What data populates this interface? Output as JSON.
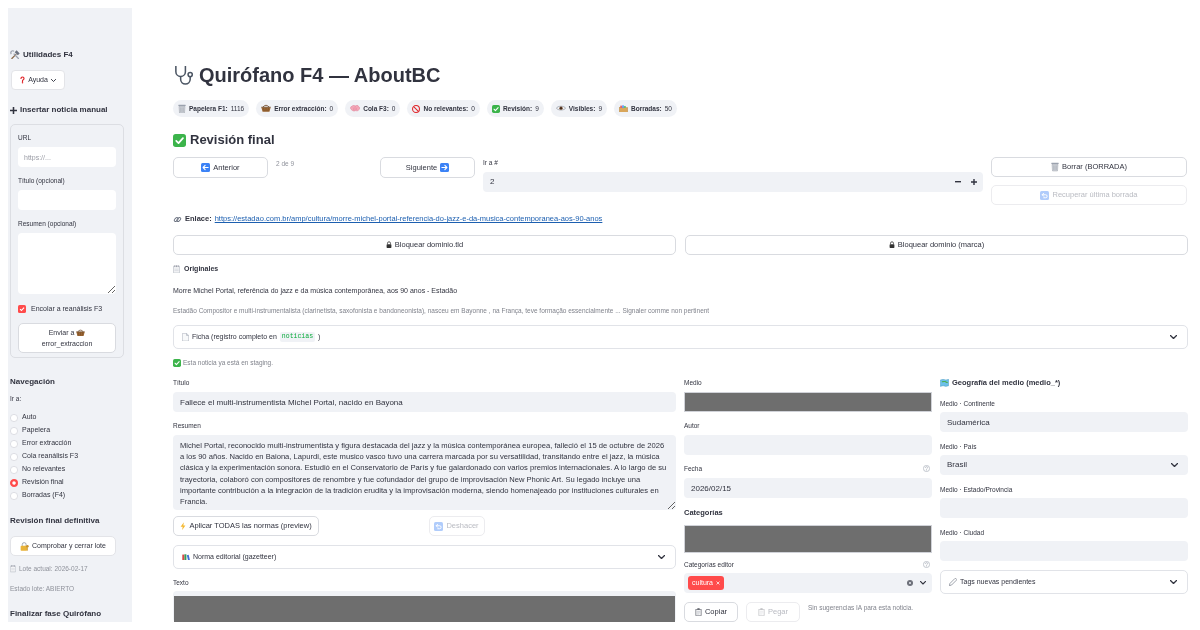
{
  "sidebar": {
    "utilities_title": "Utilidades F4",
    "help_button": {
      "label": "Ayuda",
      "expanded": false
    },
    "manual_insert": {
      "title": "Insertar noticia manual",
      "url_field": {
        "label": "URL",
        "placeholder": "https://..."
      },
      "title_field": {
        "label": "Título (opcional)"
      },
      "summary_field": {
        "label": "Resumen (opcional)"
      },
      "requeue": {
        "label": "Encolar a reanálisis F3",
        "checked": true
      },
      "send_button": {
        "label": "Enviar a",
        "target": "error_extraccion"
      }
    },
    "navigation": {
      "title": "Navegación",
      "label": "Ir a:",
      "options": [
        {
          "label": "Auto",
          "selected": false
        },
        {
          "label": "Papelera",
          "selected": false
        },
        {
          "label": "Error extracción",
          "selected": false
        },
        {
          "label": "Cola reanálisis F3",
          "selected": false
        },
        {
          "label": "No relevantes",
          "selected": false
        },
        {
          "label": "Revisión final",
          "selected": true
        },
        {
          "label": "Borradas (F4)",
          "selected": false
        }
      ]
    },
    "final_review": {
      "title": "Revisión final definitiva",
      "button": "Comprobar y cerrar lote",
      "current_batch": "Lote actual: 2026-02-17",
      "batch_status": "Estado lote: ABIERTO"
    },
    "finalize_title": "Finalizar fase Quirófano"
  },
  "header": {
    "title": "Quirófano F4 — AboutBC",
    "stats": [
      {
        "label": "Papelera F1:",
        "value": "1116"
      },
      {
        "label": "Error extracción:",
        "value": "0"
      },
      {
        "label": "Cola F3:",
        "value": "0"
      },
      {
        "label": "No relevantes:",
        "value": "0"
      },
      {
        "label": "Revisión:",
        "value": "9"
      },
      {
        "label": "Visibles:",
        "value": "9"
      },
      {
        "label": "Borradas:",
        "value": "50"
      }
    ]
  },
  "review": {
    "title": "Revisión final",
    "previous_button": "Anterior",
    "position": "2 de 9",
    "next_button": "Siguiente",
    "goto": {
      "label": "Ir a #",
      "value": "2"
    },
    "actions": [
      {
        "label": "Borrar (BORRADA)",
        "disabled": false
      },
      {
        "label": "Recuperar última borrada",
        "disabled": true
      }
    ],
    "link": {
      "label": "Enlace:",
      "url": "https://estadao.com.br/amp/cultura/morre-michel-portal-referencia-do-jazz-e-da-musica-contemporanea-aos-90-anos"
    },
    "block_buttons": [
      "Bloquear dominio.tld",
      "Bloquear dominio (marca)"
    ],
    "originals": {
      "title": "Originales",
      "headline": "Morre Michel Portal, referência do jazz e da música contemporânea, aos 90 anos - Estadão",
      "snippet": "Estadão Compositor e multi-instrumentalista (clarinetista, saxofonista e bandoneonista), nasceu em Bayonne , na França, teve formação essencialmente ... Signaler comme non pertinent"
    },
    "record_expander": {
      "label": "Ficha (registro completo en",
      "code": "noticias",
      "label_end": ")",
      "expanded": false
    },
    "staging_note": "Esta noticia ya está en staging."
  },
  "editor": {
    "title_field": {
      "label": "Título",
      "value": "Fallece el multi-instrumentista Michel Portal, nacido en Bayona"
    },
    "summary_field": {
      "label": "Resumen",
      "value": "Michel Portal, reconocido multi-instrumentista y figura destacada del jazz y la música contemporánea europea, falleció el 15 de octubre de 2026 a los 90 años. Nacido en Baiona, Lapurdi, este musico vasco tuvo una carrera marcada por su versatilidad, transitando entre el jazz, la música clásica y la experimentación sonora. Estudió en el Conservatorio de París y fue galardonado con varios premios internacionales. A lo largo de su trayectoria, colaboró con compositores de renombre y fue cofundador del grupo de improvisación New Phonic Art. Su legado incluye una importante contribución a la integración de la tradición erudita y la improvisación moderna, siendo homenajeado por instituciones culturales en Francia."
    },
    "rule_buttons": [
      {
        "label": "Aplicar TODAS las normas (preview)",
        "disabled": false
      },
      {
        "label": "Deshacer",
        "disabled": true
      }
    ],
    "norm_expander": {
      "label": "Norma editorial (gazetteer)",
      "expanded": false
    },
    "text_field": {
      "label": "Texto",
      "redacted": true
    }
  },
  "metadata": {
    "medio": {
      "label": "Medio",
      "redacted": true
    },
    "autor": {
      "label": "Autor"
    },
    "fecha": {
      "label": "Fecha",
      "value": "2026/02/15"
    },
    "categorias": {
      "title": "Categorías",
      "redacted": true
    },
    "categorias_editor": {
      "label": "Categorías editor",
      "tags": [
        "cultura"
      ]
    },
    "clipboard_buttons": [
      {
        "label": "Copiar",
        "disabled": false
      },
      {
        "label": "Pegar",
        "disabled": true
      }
    ],
    "ai_note": "Sin sugerencias IA para esta noticia."
  },
  "geography": {
    "title": "Geografía del medio (medio_*)",
    "fields": [
      {
        "label": "Medio · Continente",
        "value": "Sudamérica",
        "kind": "text"
      },
      {
        "label": "Medio · País",
        "value": "Brasil",
        "kind": "select"
      },
      {
        "label": "Medio · Estado/Provincia",
        "kind": "text"
      },
      {
        "label": "Medio · Ciudad",
        "kind": "text"
      }
    ],
    "tags_expander": {
      "label": "Tags nuevas pendientes",
      "expanded": false
    }
  }
}
